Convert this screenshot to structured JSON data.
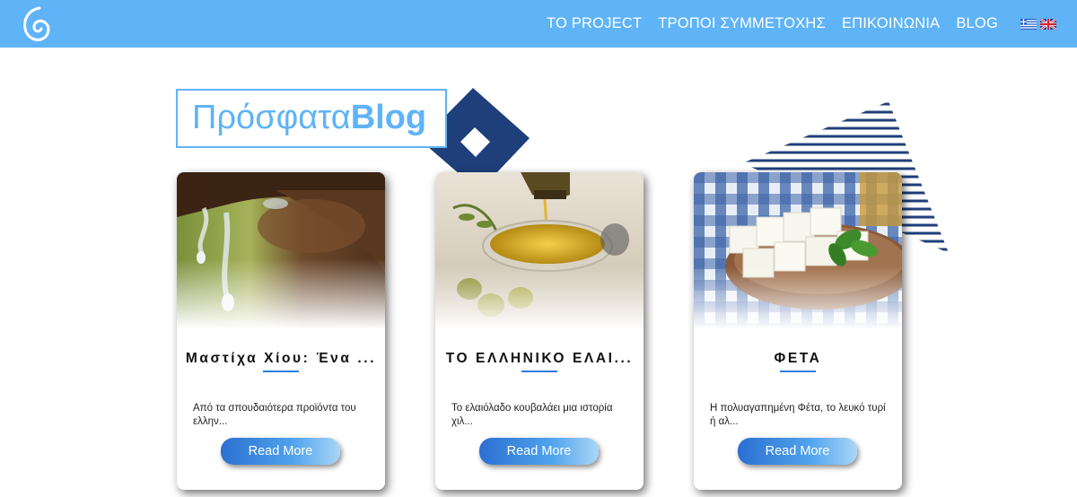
{
  "navbar": {
    "logo_icon": "spiral-logo-icon",
    "links": [
      "ΤΟ PROJECT",
      "ΤΡΟΠΟΙ ΣΥΜΜΕΤΟΧΗΣ",
      "ΕΠΙΚΟΙΝΩΝΙΑ",
      "BLOG"
    ],
    "languages": [
      "greek-flag-icon",
      "uk-flag-icon"
    ]
  },
  "section": {
    "title_light": "Πρόσφατα",
    "title_bold": "Blog"
  },
  "cards": [
    {
      "title": "Μαστίχα Χίου: Ένα ...",
      "excerpt": "Από τα σπουδαιότερα προϊόντα του ελλην...",
      "button": "Read More",
      "image": "mastic-resin-photo"
    },
    {
      "title": "ΤΟ ΕΛΛΗΝΙΚΟ ΕΛΑΙ...",
      "excerpt": "Το ελαιόλαδο κουβαλάει μια ιστορία χιλ...",
      "button": "Read More",
      "image": "olive-oil-photo"
    },
    {
      "title": "ΦΕΤΑ",
      "excerpt": "Η πολυαγαπημένη Φέτα, το λευκό τυρί ή αλ...",
      "button": "Read More",
      "image": "feta-cheese-photo"
    }
  ],
  "colors": {
    "navbar": "#5fb3f7",
    "accent_dark": "#1f3f7a",
    "button_start": "#2c6fd1",
    "button_end": "#a9d6f7"
  }
}
